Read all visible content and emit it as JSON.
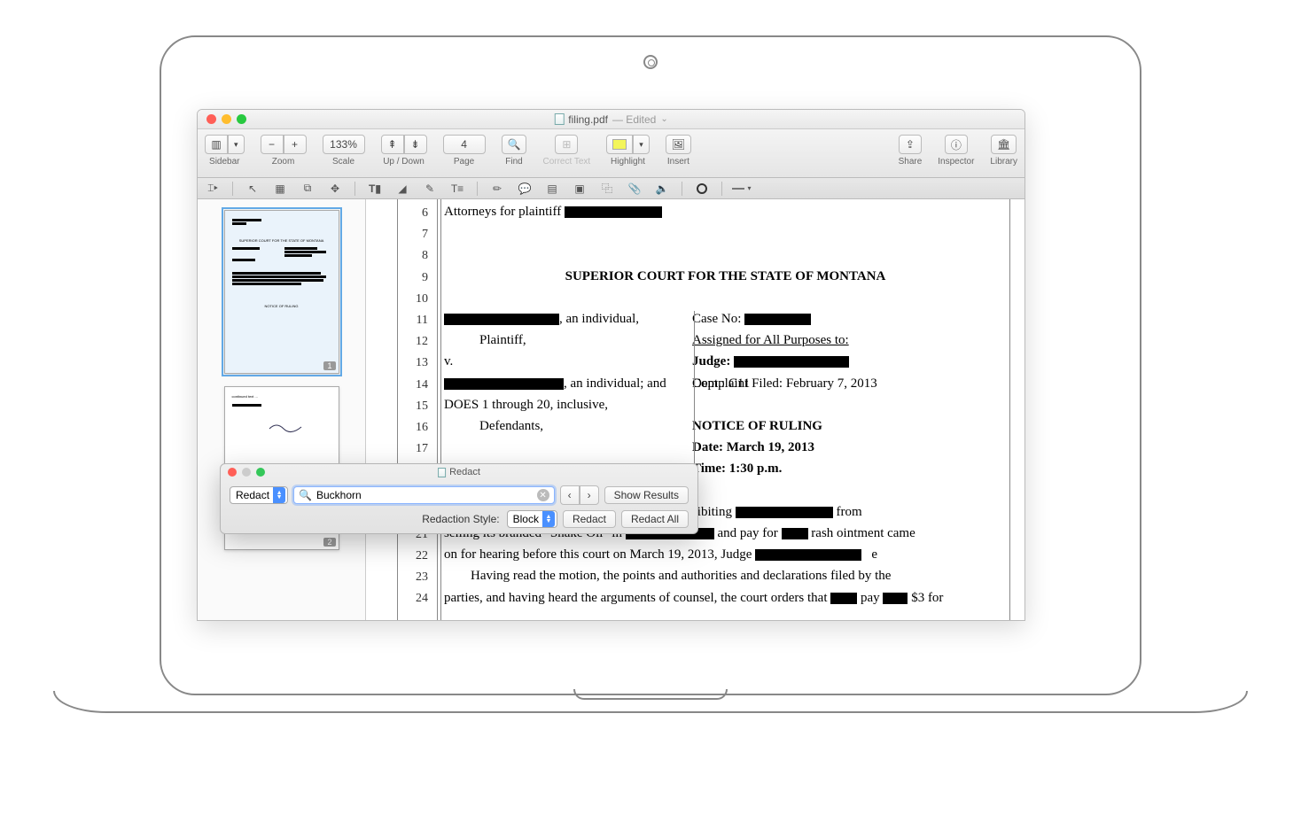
{
  "window": {
    "filename": "filing.pdf",
    "edited": "— Edited",
    "chevron": "⌄"
  },
  "toolbar": {
    "sidebar_label": "Sidebar",
    "zoom_label": "Zoom",
    "zoom_minus": "−",
    "zoom_plus": "+",
    "scale_label": "Scale",
    "scale_value": "133%",
    "updown_label": "Up / Down",
    "page_label": "Page",
    "page_value": "4",
    "find_label": "Find",
    "correct_label": "Correct Text",
    "highlight_label": "Highlight",
    "insert_label": "Insert",
    "share_label": "Share",
    "inspector_label": "Inspector",
    "library_label": "Library"
  },
  "editbar": {
    "icons": [
      "cursor-text",
      "pointer",
      "table",
      "crop",
      "move",
      "redact",
      "text-tool",
      "eraser",
      "signature",
      "text-style",
      "marker",
      "speech",
      "note",
      "stamp",
      "copy",
      "clip",
      "sound"
    ]
  },
  "sidebar": {
    "page1_num": "1",
    "page2_num": "2"
  },
  "doc": {
    "line_start": 6,
    "line_end": 24,
    "attorneys": "Attorneys for plaintiff",
    "court_title": "SUPERIOR COURT FOR THE STATE OF MONTANA",
    "individual": ", an individual,",
    "plaintiff": "Plaintiff,",
    "vs": "v.",
    "def1": ", an individual; and",
    "def2": "DOES 1 through 20, inclusive,",
    "defendants": "Defendants,",
    "caseno": "Case No:",
    "assigned": "Assigned for All Purposes to:",
    "judge": "Judge:",
    "dept": "Dept.: C11",
    "complaint": "Complaint Filed: February 7, 2013",
    "notice": "NOTICE OF RULING",
    "date": "Date: March 19, 2013",
    "time": "Time: 1:30 p.m.",
    "para1a": "for an order prohibiting",
    "para1b": "from",
    "para2a": "selling its branded \"Snake Oil\" in",
    "para2b": "and pay for",
    "para2c": "rash ointment came",
    "para3a": "on for hearing before this court on March 19, 2013, Judge",
    "para3b": "e",
    "para4": "Having read the motion, the points and authorities and declarations filed by the",
    "para5a": "parties, and having heard the arguments of counsel, the court orders that",
    "para5b": "pay",
    "para5c": "$3 for"
  },
  "redact_panel": {
    "title": "Redact",
    "mode": "Redact",
    "search_value": "Buckhorn",
    "prev": "‹",
    "next": "›",
    "show_results": "Show Results",
    "style_label": "Redaction Style:",
    "style_value": "Block",
    "redact_btn": "Redact",
    "redact_all": "Redact All"
  }
}
